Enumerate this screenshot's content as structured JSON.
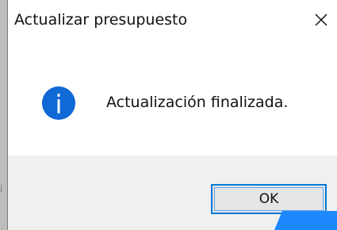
{
  "window": {
    "title": "Actualizar presupuesto",
    "close_icon": "close-icon"
  },
  "dialog": {
    "icon": "info-icon",
    "message": "Actualización finalizada."
  },
  "buttons": {
    "ok_label": "OK"
  },
  "colors": {
    "accent": "#0078d7",
    "info_icon_fill": "#0b5ed7",
    "footer_bg": "#f0f0f0",
    "text": "#111111"
  },
  "background": {
    "partial_glyph": "i"
  }
}
